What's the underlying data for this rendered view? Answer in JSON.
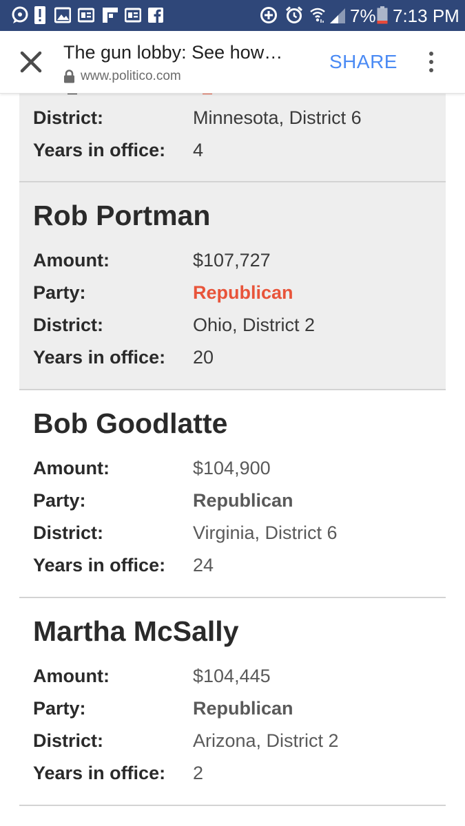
{
  "status_bar": {
    "battery_percent": "7%",
    "time": "7:13 PM",
    "left_icons": [
      "messenger-icon",
      "alert-icon",
      "image-icon",
      "news-icon",
      "flipboard-icon",
      "news-icon",
      "facebook-icon"
    ],
    "right_icons": [
      "data-saver-icon",
      "alarm-icon",
      "wifi-icon",
      "signal-icon",
      "battery-icon"
    ]
  },
  "toolbar": {
    "title": "The gun lobby: See how…",
    "url": "www.politico.com",
    "share_label": "SHARE"
  },
  "colors": {
    "status_bar": "#2f4779",
    "share": "#4a8af4",
    "party": "#e8543a",
    "card_shaded": "#eeeeee"
  },
  "labels": {
    "amount": "Amount:",
    "party": "Party:",
    "district": "District:",
    "years": "Years in office:"
  },
  "partial_card": {
    "district": "Minnesota, District 6",
    "years": "4"
  },
  "cards": [
    {
      "name": "Rob Portman",
      "amount": "$107,727",
      "party": "Republican",
      "district": "Ohio, District 2",
      "years": "20"
    },
    {
      "name": "Bob Goodlatte",
      "amount": "$104,900",
      "party": "Republican",
      "district": "Virginia, District 6",
      "years": "24"
    },
    {
      "name": "Martha McSally",
      "amount": "$104,445",
      "party": "Republican",
      "district": "Arizona, District 2",
      "years": "2"
    }
  ]
}
